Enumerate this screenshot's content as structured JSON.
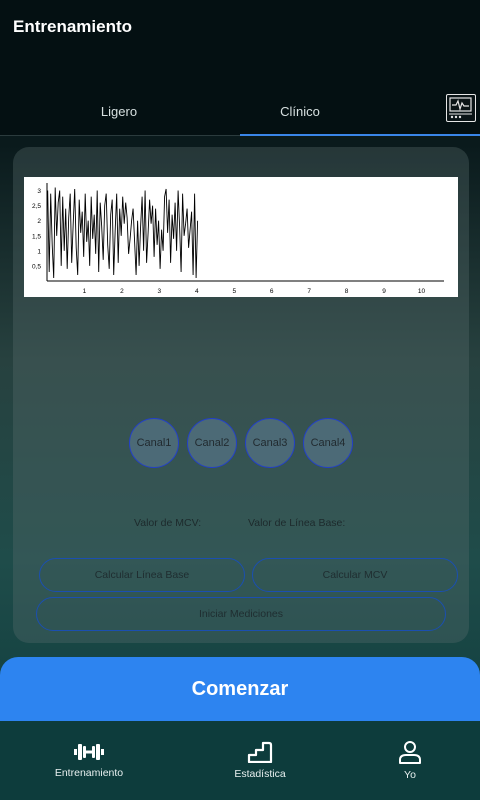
{
  "app": {
    "title": "Entrenamiento"
  },
  "tabs": [
    {
      "label": "Ligero",
      "selected": false
    },
    {
      "label": "Clínico",
      "selected": true
    }
  ],
  "monitor_icon": "ecg-monitor-icon",
  "chart_data": {
    "type": "line",
    "title": "",
    "xlabel": "",
    "ylabel": "",
    "xlim": [
      0,
      10.6
    ],
    "ylim": [
      0,
      3.25
    ],
    "x_ticks": [
      1,
      2,
      3,
      4,
      5,
      6,
      7,
      8,
      9,
      10
    ],
    "x_tick_labels": [
      "1",
      "2",
      "3",
      "4",
      "5",
      "6",
      "7",
      "8",
      "9",
      "10"
    ],
    "y_ticks": [
      0.5,
      1,
      1.5,
      2,
      2.5,
      3
    ],
    "y_tick_labels": [
      "0,5",
      "1",
      "1,5",
      "2",
      "2,5",
      "3"
    ],
    "series": [
      {
        "color": "#000000",
        "x": [
          0.02,
          0.06,
          0.1,
          0.14,
          0.18,
          0.22,
          0.26,
          0.3,
          0.34,
          0.38,
          0.42,
          0.46,
          0.5,
          0.54,
          0.58,
          0.62,
          0.66,
          0.7,
          0.74,
          0.78,
          0.82,
          0.86,
          0.9,
          0.94,
          0.98,
          1.02,
          1.06,
          1.1,
          1.14,
          1.18,
          1.22,
          1.26,
          1.3,
          1.34,
          1.38,
          1.42,
          1.46,
          1.5,
          1.54,
          1.58,
          1.62,
          1.66,
          1.7,
          1.74,
          1.78,
          1.82,
          1.86,
          1.9,
          1.94,
          1.98,
          2.02,
          2.06,
          2.1,
          2.14,
          2.18,
          2.22,
          2.26,
          2.3,
          2.34,
          2.38,
          2.42,
          2.46,
          2.5,
          2.54,
          2.58,
          2.62,
          2.66,
          2.7,
          2.74,
          2.78,
          2.82,
          2.86,
          2.9,
          2.94,
          2.98,
          3.02,
          3.06,
          3.1,
          3.14,
          3.18,
          3.22,
          3.26,
          3.3,
          3.34,
          3.38,
          3.42,
          3.46,
          3.5,
          3.54,
          3.58,
          3.62,
          3.66,
          3.7,
          3.74,
          3.78,
          3.82,
          3.86,
          3.9,
          3.94,
          3.98,
          4.02
        ],
        "y": [
          3.0,
          0.3,
          2.9,
          1.2,
          0.1,
          3.1,
          1.5,
          2.6,
          3.0,
          0.5,
          2.8,
          1.0,
          2.4,
          0.4,
          2.1,
          2.9,
          0.6,
          1.9,
          3.05,
          1.1,
          0.2,
          2.7,
          1.6,
          2.3,
          0.8,
          2.9,
          1.3,
          2.0,
          0.5,
          2.8,
          1.4,
          2.2,
          0.9,
          3.0,
          0.3,
          2.6,
          1.8,
          0.7,
          2.5,
          2.9,
          1.2,
          0.4,
          2.2,
          2.7,
          0.2,
          1.7,
          2.9,
          0.6,
          2.4,
          1.5,
          2.8,
          1.9,
          2.6,
          2.1,
          0.9,
          1.4,
          2.0,
          2.4,
          1.3,
          0.2,
          2.0,
          0.5,
          1.8,
          2.8,
          1.0,
          3.0,
          0.6,
          1.6,
          2.7,
          1.9,
          2.5,
          0.8,
          2.4,
          1.2,
          2.0,
          0.4,
          1.7,
          1.0,
          2.8,
          3.05,
          1.6,
          2.7,
          0.6,
          2.2,
          1.4,
          2.6,
          1.0,
          3.0,
          1.8,
          0.3,
          2.9,
          1.5,
          1.9,
          2.4,
          1.1,
          1.7,
          2.3,
          0.2,
          2.9,
          0.1,
          2.0
        ]
      }
    ]
  },
  "channels": [
    "Canal1",
    "Canal2",
    "Canal3",
    "Canal4"
  ],
  "labels": {
    "mcv": "Valor de MCV:",
    "baseline": "Valor de Línea Base:"
  },
  "buttons": {
    "calc_baseline": "Calcular Línea Base",
    "calc_mcv": "Calcular MCV",
    "start_measurements": "Iniciar Mediciones",
    "start": "Comenzar"
  },
  "nav": [
    {
      "label": "Entrenamiento",
      "icon": "dumbbell-icon"
    },
    {
      "label": "Estadística",
      "icon": "stats-steps-icon"
    },
    {
      "label": "Yo",
      "icon": "user-icon"
    }
  ]
}
